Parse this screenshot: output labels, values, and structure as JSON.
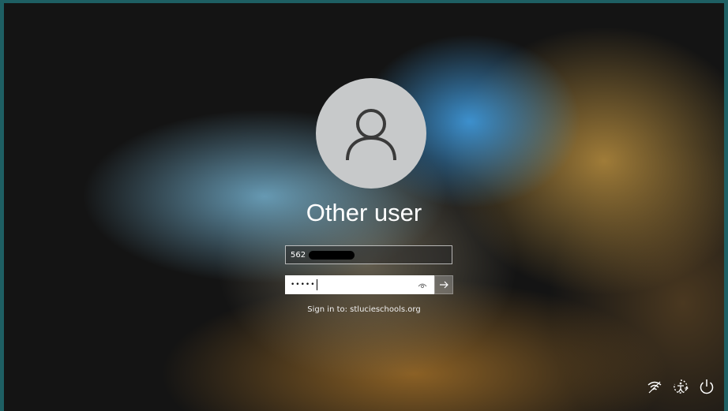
{
  "user": {
    "name": "Other user",
    "username_value": "562",
    "password_mask": "•••••"
  },
  "signin": {
    "domain_text": "Sign in to: stlucieschools.org"
  },
  "icons": {
    "avatar": "user-icon",
    "reveal": "eye-icon",
    "submit": "arrow-right-icon",
    "network": "wifi-icon",
    "ease_of_access": "ease-of-access-icon",
    "power": "power-icon"
  }
}
